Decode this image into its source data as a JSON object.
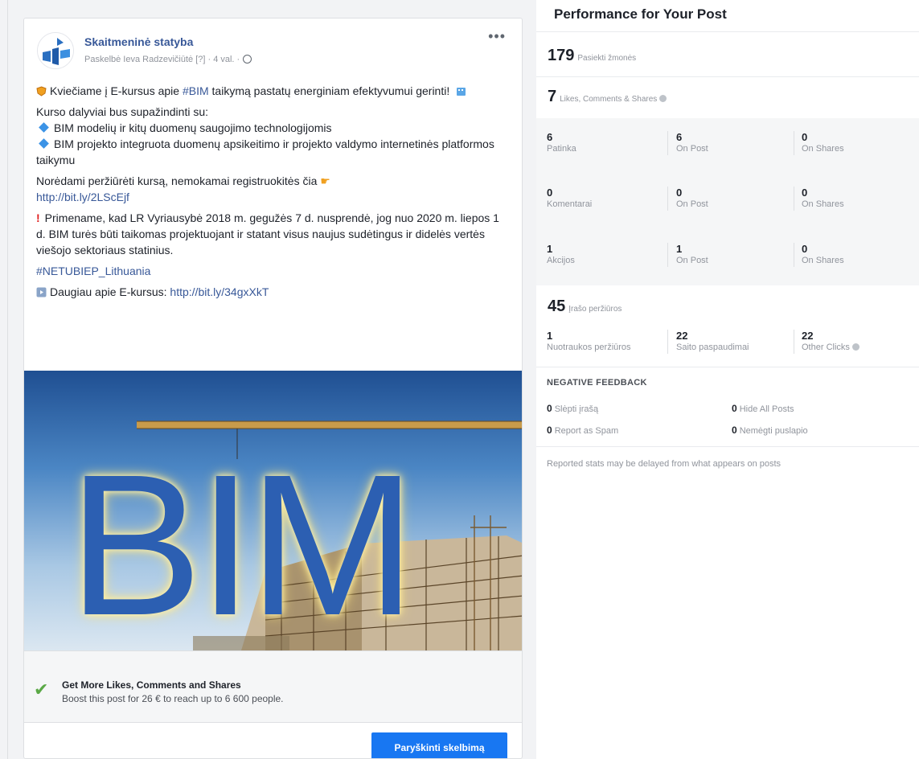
{
  "post": {
    "page_name": "Skaitmeninė statyba",
    "byline": "Paskelbė Ieva Radzevičiūtė [?] · 4 val. ·",
    "body": {
      "intro_a": "Kviečiame į E-kursus apie ",
      "intro_hashtag": "#BIM",
      "intro_b": " taikymą pastatų energiniam efektyvumui gerinti!",
      "participants": "Kurso dalyviai bus supažindinti su:",
      "bullet1": "BIM modelių ir kitų duomenų saugojimo technologijomis",
      "bullet2": "BIM projekto integruota duomenų apsikeitimo ir projekto valdymo internetinės platformos taikymu",
      "register": "Norėdami peržiūrėti kursą, nemokamai registruokitės čia",
      "register_link": "http://bit.ly/2LScEjf",
      "reminder": "Primename, kad LR Vyriausybė 2018 m. gegužės 7 d. nusprendė, jog nuo 2020 m. liepos 1 d. BIM turės būti taikomas projektuojant ir statant visus naujus sudėtingus ir didelės vertės viešojo sektoriaus statinius.",
      "hashtag": "#NETUBIEP_Lithuania",
      "more_text": "Daugiau apie E-kursus: ",
      "more_link": "http://bit.ly/34gxXkT"
    },
    "image_text": "BIM",
    "boost": {
      "title": "Get More Likes, Comments and Shares",
      "subtitle": "Boost this post for 26 € to reach up to 6 600 people.",
      "button": "Paryškinti skelbimą"
    }
  },
  "performance": {
    "title": "Performance for Your Post",
    "reach": {
      "value": "179",
      "label": "Pasiekti žmonės"
    },
    "engagement": {
      "value": "7",
      "label": "Likes, Comments & Shares"
    },
    "rows": [
      [
        {
          "n": "6",
          "l": "Patinka"
        },
        {
          "n": "6",
          "l": "On Post"
        },
        {
          "n": "0",
          "l": "On Shares"
        }
      ],
      [
        {
          "n": "0",
          "l": "Komentarai"
        },
        {
          "n": "0",
          "l": "On Post"
        },
        {
          "n": "0",
          "l": "On Shares"
        }
      ],
      [
        {
          "n": "1",
          "l": "Akcijos"
        },
        {
          "n": "1",
          "l": "On Post"
        },
        {
          "n": "0",
          "l": "On Shares"
        }
      ]
    ],
    "views": {
      "value": "45",
      "label": "Įrašo peržiūros"
    },
    "clicks": [
      {
        "n": "1",
        "l": "Nuotraukos peržiūros"
      },
      {
        "n": "22",
        "l": "Saito paspaudimai"
      },
      {
        "n": "22",
        "l": "Other Clicks"
      }
    ],
    "negative": {
      "title": "NEGATIVE FEEDBACK",
      "items": [
        {
          "n": "0",
          "l": "Slėpti įrašą"
        },
        {
          "n": "0",
          "l": "Hide All Posts"
        },
        {
          "n": "0",
          "l": "Report as Spam"
        },
        {
          "n": "0",
          "l": "Nemėgti puslapio"
        }
      ]
    },
    "disclaimer": "Reported stats may be delayed from what appears on posts"
  },
  "colors": {
    "link": "#385898",
    "boost_button": "#1877f2",
    "check": "#5aa846"
  }
}
